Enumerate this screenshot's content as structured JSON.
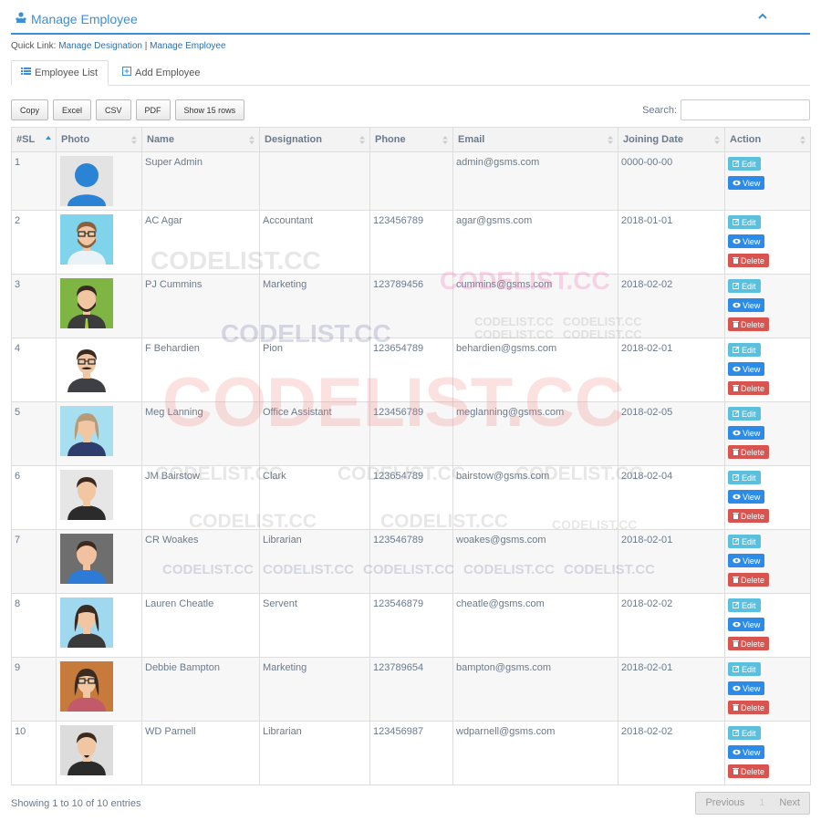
{
  "panel": {
    "title": "Manage Employee"
  },
  "quick_links": {
    "label": "Quick Link:",
    "link1": "Manage Designation",
    "separator": "|",
    "link2": "Manage Employee"
  },
  "tabs": {
    "list": "Employee List",
    "add": "Add Employee"
  },
  "toolbar": {
    "copy": "Copy",
    "excel": "Excel",
    "csv": "CSV",
    "pdf": "PDF",
    "show_rows": "Show 15 rows"
  },
  "search": {
    "label": "Search:",
    "value": ""
  },
  "table": {
    "columns": [
      "#SL",
      "Photo",
      "Name",
      "Designation",
      "Phone",
      "Email",
      "Joining Date",
      "Action"
    ],
    "rows": [
      {
        "sl": "1",
        "name": "Super Admin",
        "designation": "",
        "phone": "",
        "email": "admin@gsms.com",
        "date": "0000-00-00",
        "avatar": "default-user",
        "deletable": false
      },
      {
        "sl": "2",
        "name": "AC Agar",
        "designation": "Accountant",
        "phone": "123456789",
        "email": "agar@gsms.com",
        "date": "2018-01-01",
        "avatar": "man-glasses-beard",
        "deletable": true
      },
      {
        "sl": "3",
        "name": "PJ Cummins",
        "designation": "Marketing",
        "phone": "123789456",
        "email": "cummins@gsms.com",
        "date": "2018-02-02",
        "avatar": "man-beard-tie",
        "deletable": true
      },
      {
        "sl": "4",
        "name": "F Behardien",
        "designation": "Pion",
        "phone": "123654789",
        "email": "behardien@gsms.com",
        "date": "2018-02-01",
        "avatar": "man-glasses-mustache",
        "deletable": true
      },
      {
        "sl": "5",
        "name": "Meg Lanning",
        "designation": "Office Assistant",
        "phone": "123456789",
        "email": "meglanning@gsms.com",
        "date": "2018-02-05",
        "avatar": "woman-short-hair",
        "deletable": true
      },
      {
        "sl": "6",
        "name": "JM Bairstow",
        "designation": "Clark",
        "phone": "123654789",
        "email": "bairstow@gsms.com",
        "date": "2018-02-04",
        "avatar": "man-suit",
        "deletable": true
      },
      {
        "sl": "7",
        "name": "CR Woakes",
        "designation": "Librarian",
        "phone": "123546789",
        "email": "woakes@gsms.com",
        "date": "2018-02-01",
        "avatar": "man-faceless",
        "deletable": true
      },
      {
        "sl": "8",
        "name": "Lauren Cheatle",
        "designation": "Servent",
        "phone": "123546879",
        "email": "cheatle@gsms.com",
        "date": "2018-02-02",
        "avatar": "woman-dark-hair",
        "deletable": true
      },
      {
        "sl": "9",
        "name": "Debbie Bampton",
        "designation": "Marketing",
        "phone": "123789654",
        "email": "bampton@gsms.com",
        "date": "2018-02-01",
        "avatar": "woman-glasses",
        "deletable": true
      },
      {
        "sl": "10",
        "name": "WD Parnell",
        "designation": "Librarian",
        "phone": "123456987",
        "email": "wdparnell@gsms.com",
        "date": "2018-02-02",
        "avatar": "man-goatee",
        "deletable": true
      }
    ]
  },
  "actions": {
    "edit": "Edit",
    "view": "View",
    "delete": "Delete"
  },
  "footer": {
    "info": "Showing 1 to 10 of 10 entries",
    "previous": "Previous",
    "page": "1",
    "next": "Next"
  },
  "watermark": {
    "text": "CODELIST.CC"
  },
  "colors": {
    "accent": "#3a8fd6",
    "edit": "#5bc0de",
    "view": "#2b8be6",
    "delete": "#d9534f"
  }
}
